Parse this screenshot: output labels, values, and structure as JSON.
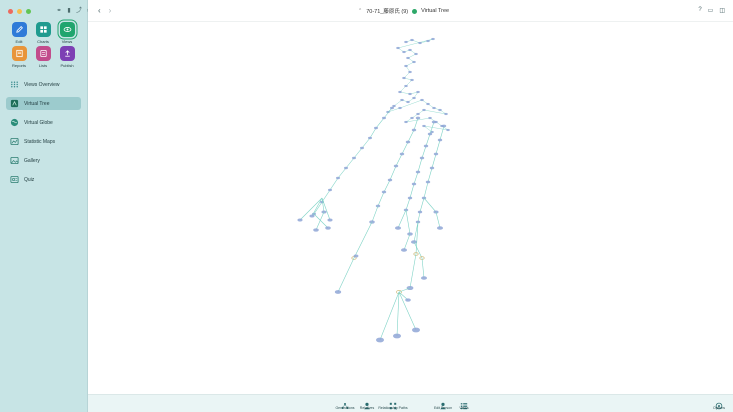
{
  "window": {
    "title": "70-71_藤原氏 (9)",
    "view_name": "Virtual Tree"
  },
  "sidebar": {
    "tiles": [
      {
        "label": "Edit",
        "color": "#2f7bd8"
      },
      {
        "label": "Charts",
        "color": "#1f9b8f"
      },
      {
        "label": "Views",
        "color": "#20a56e"
      },
      {
        "label": "Reports",
        "color": "#e8953a"
      },
      {
        "label": "Lists",
        "color": "#c24c8c"
      },
      {
        "label": "Publish",
        "color": "#7d3fb4"
      }
    ],
    "items": [
      {
        "label": "Views Overview",
        "active": false
      },
      {
        "label": "Virtual Tree",
        "active": true
      },
      {
        "label": "Virtual Globe",
        "active": false
      },
      {
        "label": "Statistic Maps",
        "active": false
      },
      {
        "label": "Gallery",
        "active": false
      },
      {
        "label": "Quiz",
        "active": false
      }
    ]
  },
  "toolbar": {
    "items": [
      {
        "label": "Generations",
        "icon": "generations-icon"
      },
      {
        "label": "Relatives",
        "icon": "relatives-icon"
      },
      {
        "label": "Relationship Paths",
        "icon": "relationship-paths-icon"
      },
      {
        "label": "Edit Person",
        "icon": "edit-person-icon"
      },
      {
        "label": "Views",
        "icon": "views-icon"
      }
    ],
    "options_label": "Options"
  },
  "colors": {
    "sidebar_bg": "#c7e4e5",
    "edge": "#7fd3c6",
    "node": "#8fa6d6"
  }
}
